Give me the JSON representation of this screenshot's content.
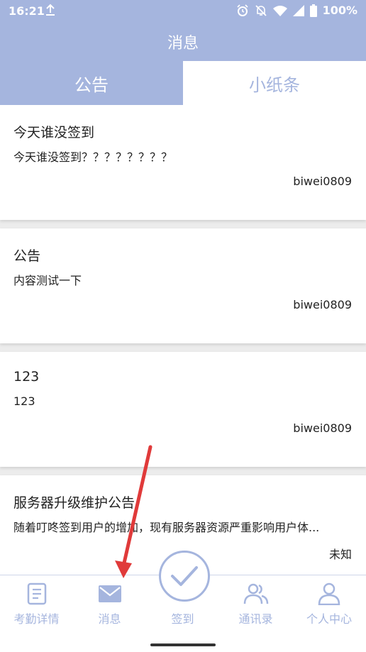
{
  "status_bar": {
    "time": "16:21",
    "battery": "100%"
  },
  "app_bar": {
    "title": "消息"
  },
  "tabs": [
    {
      "label": "公告",
      "active": true
    },
    {
      "label": "小纸条",
      "active": false
    }
  ],
  "cards": [
    {
      "title": "今天谁没签到",
      "body": "今天谁没签到？？？？？？？？",
      "author": "biwei0809"
    },
    {
      "title": "公告",
      "body": "内容测试一下",
      "author": "biwei0809"
    },
    {
      "title": "123",
      "body": "123",
      "author": "biwei0809"
    },
    {
      "title": "服务器升级维护公告",
      "body": "随着叮咚签到用户的增加，现有服务器资源严重影响用户体...",
      "author": "未知"
    }
  ],
  "bottom_nav": [
    {
      "label": "考勤详情",
      "icon": "document-icon"
    },
    {
      "label": "消息",
      "icon": "mail-icon"
    },
    {
      "label": "签到",
      "icon": "check-circle-icon"
    },
    {
      "label": "通讯录",
      "icon": "contacts-icon"
    },
    {
      "label": "个人中心",
      "icon": "person-icon"
    }
  ],
  "colors": {
    "accent": "#a5b5de",
    "annotation_arrow": "#e03a3a"
  }
}
